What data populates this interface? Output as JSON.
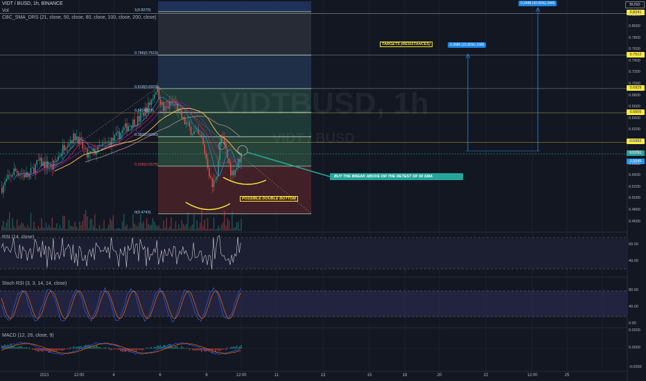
{
  "legend": {
    "symbol": "VIDT / BUSD, 1h, BINANCE",
    "vol": "Vol",
    "sma": "CBC_SMA_DRS (21, close, 50, close, 80, close, 100, close, 200, close)",
    "rsi": "RSI (14, close)",
    "stoch": "Stoch RSI (3, 3, 14, 14, close)",
    "macd": "MACD (12, 26, close, 9)"
  },
  "watermark": {
    "main": "VIDTBUSD, 1h",
    "sub": "VIDT / BUSD"
  },
  "annotations": {
    "targets": "TARGETS (RESISTANCES)",
    "buy": "BUY THE BREAK ABOVE OR THE RETEST OF 50 SMA",
    "double_bottom": "POSSIBLE DOUBLE BOTTOM",
    "measure1": "0.3686 (23.96%) 1586",
    "measure2": "0.2448 (42.05%) 2446"
  },
  "colors": {
    "background": "#131722",
    "up": "#26a69a",
    "down": "#ef5350",
    "fib_line": "#b8d4c8",
    "target_line": "#c8c84a",
    "measure": "#2196f3",
    "teal_callout": "#26a69a",
    "rsi_line": "#d1d4dc",
    "stoch_k": "#2962ff",
    "stoch_d": "#ff6d00",
    "macd_line": "#2962ff",
    "signal_line": "#ff6d00",
    "annotation_bg": "#ffeb3b"
  },
  "fib_levels": [
    {
      "label": "1(0.8270)",
      "price": 0.827
    },
    {
      "label": "0.786(0.7515)",
      "price": 0.7515
    },
    {
      "label": "0.618(0.6929)",
      "price": 0.6929
    },
    {
      "label": "0.5(0.6515)",
      "price": 0.6515
    },
    {
      "label": "0.382(0.6090)",
      "price": 0.609
    },
    {
      "label": "0.236(0.5575)",
      "price": 0.5575
    },
    {
      "label": "0(0.4743)",
      "price": 0.4743
    }
  ],
  "target_levels": [
    {
      "price": 0.8241,
      "tag": "0.8241"
    },
    {
      "price": 0.7512,
      "tag": "0.7512"
    },
    {
      "price": 0.6929,
      "tag": "0.6929"
    },
    {
      "price": 0.6505,
      "tag": "0.6505"
    },
    {
      "price": 0.5992,
      "tag": "0.5992"
    }
  ],
  "price_tags": [
    {
      "price": 0.5791,
      "tag": "0.5791",
      "kind": "current"
    },
    {
      "price": 0.5645,
      "tag": "0.5645",
      "kind": "sma"
    },
    {
      "price": 0.84,
      "tag": "BUSD",
      "kind": "currency"
    }
  ],
  "axes": {
    "price_ticks": [
      0.84,
      0.82,
      0.8,
      0.78,
      0.76,
      0.74,
      0.72,
      0.7,
      0.68,
      0.66,
      0.64,
      0.62,
      0.6,
      0.58,
      0.56,
      0.54,
      0.52,
      0.5,
      0.48,
      0.46
    ],
    "price_tick_labels": [
      "0.8400",
      "0.8200",
      "0.8000",
      "0.7800",
      "0.7600",
      "0.7400",
      "0.7200",
      "0.7000",
      "0.6800",
      "0.6600",
      "0.6400",
      "0.6200",
      "0.6000",
      "0.5800",
      "0.5600",
      "0.5400",
      "0.5200",
      "0.5000",
      "0.4800",
      "0.4600"
    ],
    "rsi_ticks": [
      "60.00",
      "40.00"
    ],
    "stoch_ticks": [
      "80.00",
      "40.00",
      "0.00"
    ],
    "macd_ticks": [
      "0.0200",
      "0.0000",
      "-0.0200"
    ],
    "x_labels": [
      "2021",
      "12:00",
      "4",
      "6",
      "8",
      "12:00",
      "11",
      "13",
      "15",
      "18",
      "20",
      "22",
      "12:00",
      "25"
    ]
  },
  "chart_data": {
    "type": "candlestick",
    "title": "VIDT / BUSD, 1h, BINANCE",
    "price_range": [
      0.445,
      0.845
    ],
    "ohlc_summary": {
      "start_price": 0.52,
      "peak_price": 0.695,
      "last_price": 0.579,
      "drop_low": 0.472
    },
    "indicators": [
      "RSI (14, close)",
      "Stoch RSI (3, 3, 14, 14, close)",
      "MACD (12, 26, close, 9)"
    ],
    "rsi_range": [
      30,
      70
    ],
    "macd_range": [
      -0.02,
      0.02
    ]
  }
}
